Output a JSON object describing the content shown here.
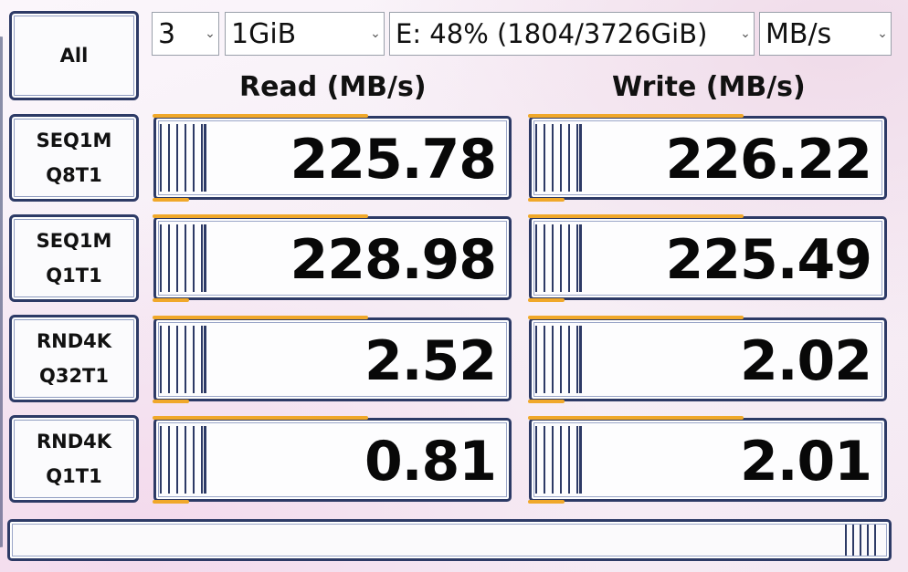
{
  "controls": {
    "all_button_label": "All",
    "test_count": "3",
    "test_size": "1GiB",
    "drive": "E: 48% (1804/3726GiB)",
    "unit": "MB/s"
  },
  "headers": {
    "read": "Read (MB/s)",
    "write": "Write (MB/s)"
  },
  "tests": [
    {
      "line1": "SEQ1M",
      "line2": "Q8T1",
      "read": "225.78",
      "write": "226.22"
    },
    {
      "line1": "SEQ1M",
      "line2": "Q1T1",
      "read": "228.98",
      "write": "225.49"
    },
    {
      "line1": "RND4K",
      "line2": "Q32T1",
      "read": "2.52",
      "write": "2.02"
    },
    {
      "line1": "RND4K",
      "line2": "Q1T1",
      "read": "0.81",
      "write": "2.01"
    }
  ],
  "status": {
    "text": ""
  },
  "colors": {
    "frame": "#2d3a66",
    "accent": "#f0a82a"
  },
  "icons": {
    "dropdown": "chevron-down-icon"
  }
}
